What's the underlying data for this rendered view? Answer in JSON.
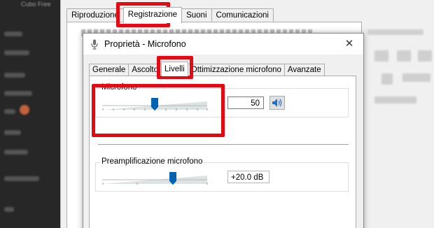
{
  "background_app": {
    "partial_title": "Cubo Free"
  },
  "back_dialog": {
    "tabs": [
      "Riproduzione",
      "Registrazione",
      "Suoni",
      "Comunicazioni"
    ],
    "active_tab_index": 1
  },
  "dialog": {
    "title": "Proprietà - Microfono",
    "close_glyph": "✕",
    "tabs": [
      "Generale",
      "Ascolto",
      "Livelli",
      "Ottimizzazione microfono",
      "Avanzate"
    ],
    "active_tab_index": 2
  },
  "levels": {
    "microphone": {
      "label": "Microfono",
      "value": "50",
      "slider_fraction": 0.5
    },
    "boost": {
      "label": "Preamplificazione microfono",
      "value": "+20.0 dB",
      "slider_fraction": 0.67
    }
  },
  "colors": {
    "highlight": "#e50914",
    "thumb": "#0063b1"
  }
}
